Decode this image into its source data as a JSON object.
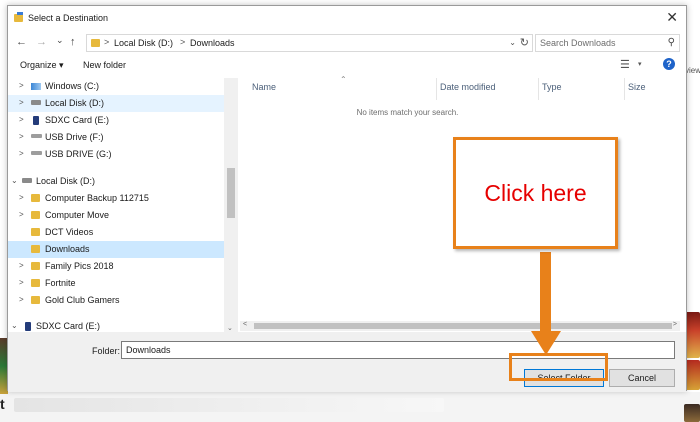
{
  "dialog": {
    "title": "Select a Destination",
    "close_glyph": "✕"
  },
  "nav": {
    "back_glyph": "←",
    "forward_glyph": "→",
    "recent_glyph": "⌄",
    "up_glyph": "↑"
  },
  "address": {
    "crumbs": [
      "Local Disk (D:)",
      "Downloads"
    ],
    "separator": ">",
    "dropdown_glyph": "⌄",
    "refresh_glyph": "↻"
  },
  "search": {
    "placeholder": "Search Downloads",
    "icon_glyph": "⚲"
  },
  "toolbar": {
    "organize_label": "Organize ▾",
    "new_folder_label": "New folder",
    "view_glyph": "☰",
    "view_dd_glyph": "▾",
    "help_glyph": "?"
  },
  "tree": {
    "items": [
      {
        "label": "Windows (C:)",
        "icon": "windows-drive-icon",
        "chev": ">"
      },
      {
        "label": "Local Disk (D:)",
        "icon": "drive-icon",
        "chev": ">"
      },
      {
        "label": "SDXC Card (E:)",
        "icon": "sd-card-icon",
        "chev": ">"
      },
      {
        "label": "USB Drive (F:)",
        "icon": "usb-drive-icon",
        "chev": ">"
      },
      {
        "label": "USB DRIVE (G:)",
        "icon": "usb-drive-icon",
        "chev": ">"
      },
      {
        "label": "Local Disk (D:)",
        "icon": "drive-icon",
        "chev": "⌄"
      },
      {
        "label": "Computer Backup 112715",
        "icon": "folder-icon",
        "chev": ">"
      },
      {
        "label": "Computer Move",
        "icon": "folder-icon",
        "chev": ">"
      },
      {
        "label": "DCT Videos",
        "icon": "folder-icon",
        "chev": ""
      },
      {
        "label": "Downloads",
        "icon": "folder-icon",
        "chev": ""
      },
      {
        "label": "Family Pics 2018",
        "icon": "folder-icon",
        "chev": ">"
      },
      {
        "label": "Fortnite",
        "icon": "folder-icon",
        "chev": ">"
      },
      {
        "label": "Gold Club Gamers",
        "icon": "folder-icon",
        "chev": ">"
      },
      {
        "label": "SDXC Card (E:)",
        "icon": "sd-card-icon",
        "chev": "⌄"
      }
    ],
    "scroll_down_glyph": "⌄"
  },
  "file_list": {
    "columns": [
      "Name",
      "Date modified",
      "Type",
      "Size"
    ],
    "sort_glyph": "⌃",
    "empty_message": "No items match your search.",
    "scroll_left_glyph": "<",
    "scroll_right_glyph": ">"
  },
  "footer": {
    "folder_label": "Folder:",
    "folder_value": "Downloads",
    "select_button": "Select Folder",
    "cancel_button": "Cancel"
  },
  "annotation": {
    "callout_text": "Click here",
    "color": "#e8811a",
    "text_color": "#e60000"
  },
  "background": {
    "right_text": "view",
    "left_char": "t"
  }
}
